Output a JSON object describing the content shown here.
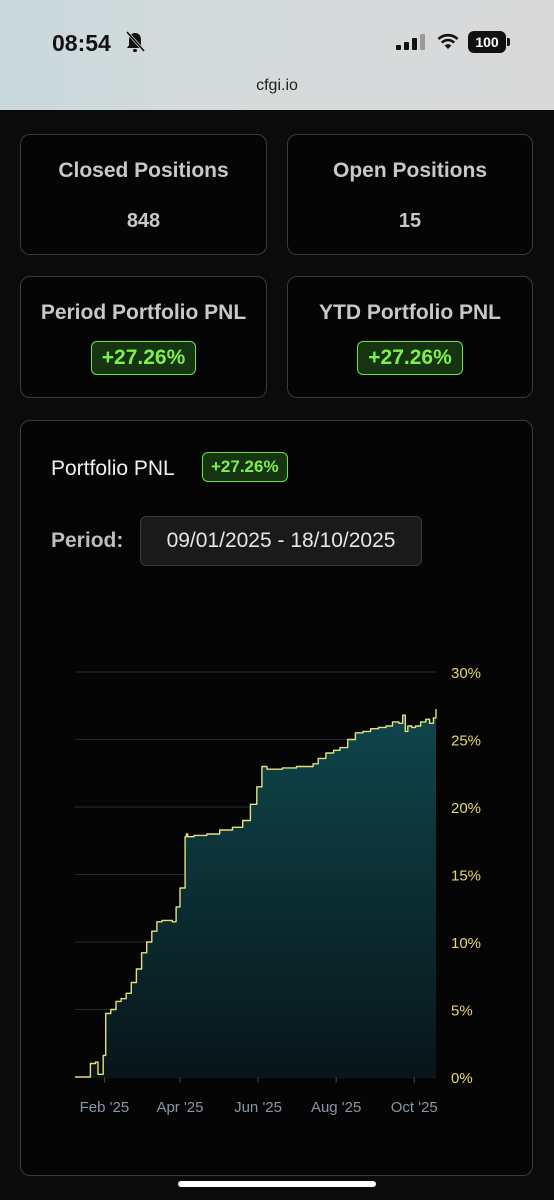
{
  "status_bar": {
    "time": "08:54",
    "battery": "100",
    "url": "cfgi.io"
  },
  "icons": {
    "mute": "bell-slash-icon",
    "signal": "cellular-signal-icon",
    "wifi": "wifi-icon",
    "battery": "battery-icon"
  },
  "stats": {
    "closed": {
      "label": "Closed Positions",
      "value": "848"
    },
    "open": {
      "label": "Open Positions",
      "value": "15"
    },
    "period_pnl": {
      "label": "Period Portfolio PNL",
      "value": "+27.26%"
    },
    "ytd_pnl": {
      "label": "YTD Portfolio PNL",
      "value": "+27.26%"
    }
  },
  "pnl_card": {
    "title": "Portfolio PNL",
    "badge": "+27.26%",
    "period_label": "Period:",
    "period_value": "09/01/2025 - 18/10/2025"
  },
  "colors": {
    "accent_green": "#7ef04c",
    "line": "#e6e07a",
    "axis_label": "#e6d86a",
    "xtick": "#8a96a8"
  },
  "chart_data": {
    "type": "area",
    "title": "",
    "xlabel": "",
    "ylabel": "",
    "ylim": [
      0,
      30
    ],
    "xlim": [
      "2025-01-09",
      "2025-10-18"
    ],
    "y_ticks": [
      "0%",
      "5%",
      "10%",
      "15%",
      "20%",
      "25%",
      "30%"
    ],
    "x_ticks": [
      {
        "label": "Feb '25",
        "date": "2025-02-01"
      },
      {
        "label": "Apr '25",
        "date": "2025-04-01"
      },
      {
        "label": "Jun '25",
        "date": "2025-06-01"
      },
      {
        "label": "Aug '25",
        "date": "2025-08-01"
      },
      {
        "label": "Oct '25",
        "date": "2025-10-01"
      }
    ],
    "grid": true,
    "series": [
      {
        "x": [
          "2025-01-09",
          "2025-01-19",
          "2025-01-21",
          "2025-01-25",
          "2025-01-27",
          "2025-01-31",
          "2025-02-02",
          "2025-02-06",
          "2025-02-10",
          "2025-02-14",
          "2025-02-18",
          "2025-02-22",
          "2025-02-26",
          "2025-03-02",
          "2025-03-06",
          "2025-03-10",
          "2025-03-14",
          "2025-03-18",
          "2025-03-22",
          "2025-03-26",
          "2025-03-29",
          "2025-04-01",
          "2025-04-05",
          "2025-04-06",
          "2025-04-07",
          "2025-04-12",
          "2025-04-22",
          "2025-05-02",
          "2025-05-12",
          "2025-05-20",
          "2025-05-26",
          "2025-05-31",
          "2025-06-04",
          "2025-06-08",
          "2025-06-12",
          "2025-06-20",
          "2025-07-01",
          "2025-07-08",
          "2025-07-14",
          "2025-07-18",
          "2025-07-24",
          "2025-07-30",
          "2025-08-04",
          "2025-08-10",
          "2025-08-16",
          "2025-08-22",
          "2025-08-28",
          "2025-09-03",
          "2025-09-09",
          "2025-09-14",
          "2025-09-19",
          "2025-09-22",
          "2025-09-24",
          "2025-09-26",
          "2025-09-29",
          "2025-10-02",
          "2025-10-06",
          "2025-10-10",
          "2025-10-13",
          "2025-10-16",
          "2025-10-18"
        ],
        "y": [
          0.0,
          0.0,
          1.0,
          1.1,
          0.2,
          1.6,
          4.7,
          5.0,
          5.6,
          5.8,
          6.2,
          7.0,
          8.0,
          9.2,
          10.0,
          10.8,
          11.5,
          11.6,
          11.6,
          11.5,
          12.6,
          14.0,
          17.8,
          18.0,
          17.8,
          17.9,
          18.0,
          18.3,
          18.5,
          19.0,
          20.2,
          21.5,
          23.0,
          22.8,
          22.8,
          22.9,
          23.0,
          23.0,
          23.2,
          23.6,
          24.0,
          24.2,
          24.4,
          25.0,
          25.5,
          25.6,
          25.8,
          25.9,
          26.0,
          26.3,
          26.2,
          26.8,
          25.6,
          26.0,
          25.9,
          26.0,
          26.3,
          26.5,
          26.2,
          26.6,
          27.26
        ]
      }
    ]
  }
}
